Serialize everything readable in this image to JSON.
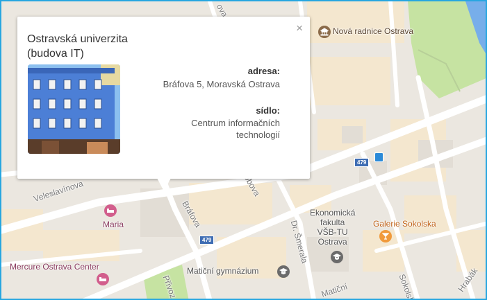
{
  "map": {
    "labels": {
      "nova_radnice": "Nová radnice Ostrava",
      "veleslavinova": "Veleslavínova",
      "maria": "Maria",
      "brafova": "Bráfova",
      "dobova": "Dobova",
      "ekonomicka": [
        "Ekonomická",
        "fakulta",
        "VŠB-TU",
        "Ostrava"
      ],
      "galerie": "Galerie Sokolska",
      "dr_smerala": "Dr. Šmerala",
      "mercure": "Mercure Ostrava Center",
      "maticni_gymnazium": "Matiční gymnázium",
      "maticni": "Matiční",
      "privoz": "Přívoz",
      "sokolska": "Sokolská",
      "hrabak": "Hrabák",
      "route_479": "479",
      "partial_top": "ova"
    },
    "colors": {
      "road": "#ffffff",
      "block": "#f4e7cf",
      "park": "#c6e3a2",
      "water": "#77aeea",
      "background": "#ebe7e0",
      "border": "#27a6e0"
    },
    "icons": [
      "town-hall-icon",
      "hotel-icon",
      "school-icon",
      "bar-icon",
      "bus-stop-icon"
    ]
  },
  "popup": {
    "title_line1": "Ostravská univerzita",
    "title_line2": "(budova IT)",
    "close": "×",
    "address_label": "adresa:",
    "address_value": "Bráfova 5, Moravská Ostrava",
    "seat_label": "sídlo:",
    "seat_value_line1": "Centrum informačních",
    "seat_value_line2": "technologií"
  }
}
